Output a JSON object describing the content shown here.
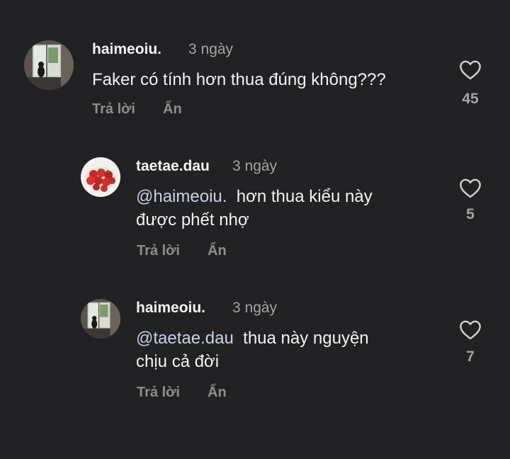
{
  "comments": [
    {
      "username": "haimeoiu.",
      "time": "3 ngày",
      "mention": "",
      "text": "Faker có tính hơn thua đúng không???",
      "reply_label": "Trả lời",
      "hide_label": "Ẩn",
      "likes": "45"
    },
    {
      "username": "taetae.dau",
      "time": "3 ngày",
      "mention": "@haimeoiu.",
      "text_line1": "hơn thua kiểu này",
      "text_line2": "được phết nhợ",
      "reply_label": "Trả lời",
      "hide_label": "Ẩn",
      "likes": "5"
    },
    {
      "username": "haimeoiu.",
      "time": "3 ngày",
      "mention": "@taetae.dau",
      "text_line1": "thua này nguyện",
      "text_line2": "chịu cả đời",
      "reply_label": "Trả lời",
      "hide_label": "Ẩn",
      "likes": "7"
    }
  ],
  "icons": {
    "like": "heart-outline-icon",
    "avatar_photo": "window-photo",
    "avatar_strawberries": "strawberries-photo"
  },
  "colors": {
    "background": "#222224",
    "text": "#f2f2f2",
    "muted": "#a4a4a4",
    "mention": "#c9d2e6"
  }
}
